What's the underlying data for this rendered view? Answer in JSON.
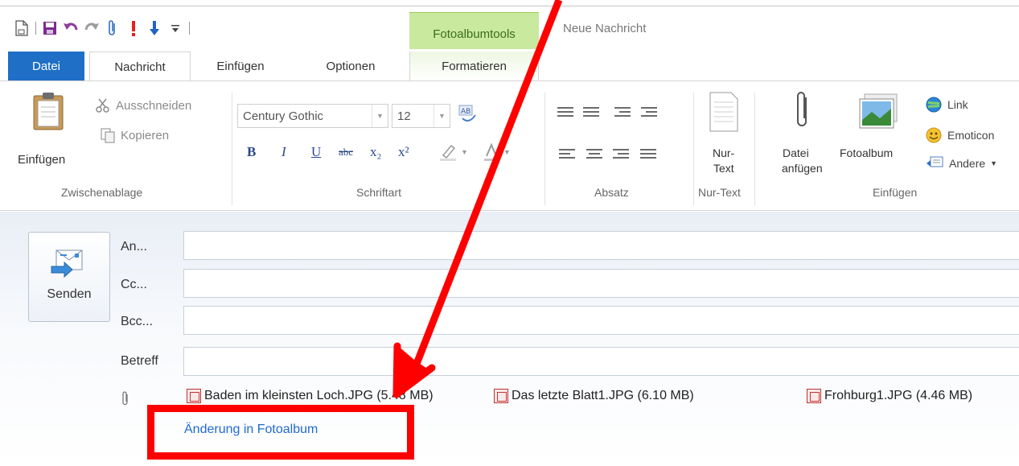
{
  "window": {
    "title": "Neue Nachricht"
  },
  "quick_access": {
    "icons": [
      "new-document-icon",
      "save-icon",
      "undo-icon",
      "redo-icon",
      "attach-icon",
      "high-priority-icon",
      "low-priority-icon",
      "customize-dropdown-icon"
    ]
  },
  "context_tab": {
    "header": "Fotoalbumtools",
    "tab_label": "Formatieren"
  },
  "tabs": {
    "file": "Datei",
    "message": "Nachricht",
    "insert": "Einfügen",
    "options": "Optionen"
  },
  "ribbon": {
    "clipboard": {
      "label": "Zwischenablage",
      "paste": "Einfügen",
      "cut": "Ausschneiden",
      "copy": "Kopieren"
    },
    "font": {
      "label": "Schriftart",
      "family": "Century Gothic",
      "size": "12",
      "bold": "B",
      "italic": "I",
      "underline": "U",
      "strike": "abc",
      "subscript": "x₂",
      "superscript": "x²"
    },
    "paragraph": {
      "label": "Absatz"
    },
    "plaintext": {
      "label": "Nur-Text",
      "button_line1": "Nur-",
      "button_line2": "Text"
    },
    "insert": {
      "label": "Einfügen",
      "attach_line1": "Datei",
      "attach_line2": "anfügen",
      "photo_album": "Fotoalbum",
      "link": "Link",
      "emoticon": "Emoticon",
      "other": "Andere"
    }
  },
  "compose": {
    "send": "Senden",
    "to_label": "An...",
    "cc_label": "Cc...",
    "bcc_label": "Bcc...",
    "subject_label": "Betreff",
    "to_value": "",
    "cc_value": "",
    "bcc_value": "",
    "subject_value": ""
  },
  "attachments": [
    {
      "name": "Baden im kleinsten Loch.JPG (5.48 MB)"
    },
    {
      "name": "Das letzte Blatt1.JPG (6.10 MB)"
    },
    {
      "name": "Frohburg1.JPG (4.46 MB)"
    }
  ],
  "album_link": "Änderung in Fotoalbum",
  "annotation": {
    "color": "#ff0000"
  }
}
